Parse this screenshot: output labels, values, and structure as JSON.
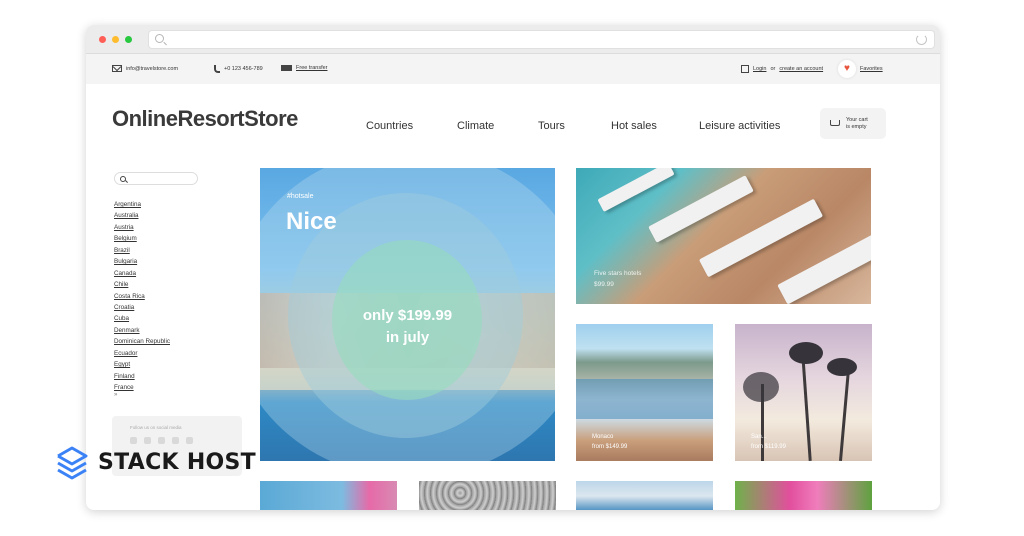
{
  "topbar": {
    "email": "info@travelstore.com",
    "phone": "+0 123 456-789",
    "transfer": "Free transfer",
    "login": "Login",
    "login_or": "or",
    "create_account": "create an account",
    "favorites": "Favorites"
  },
  "header": {
    "logo": "OnlineResortStore",
    "nav": [
      "Countries",
      "Climate",
      "Tours",
      "Hot sales",
      "Leisure activities"
    ],
    "cart_line1": "Your cart",
    "cart_line2": "is empty"
  },
  "sidebar": {
    "countries": [
      "Argentina",
      "Australia",
      "Austria",
      "Belgium",
      "Brazil",
      "Bulgaria",
      "Canada",
      "Chile",
      "Costa Rica",
      "Croatia",
      "Cuba",
      "Denmark",
      "Dominican Republic",
      "Ecuador",
      "Egypt",
      "Finland",
      "France"
    ],
    "more": "»",
    "social_label": "Follow us on social media"
  },
  "hero": {
    "tag": "#hotsale",
    "title": "Nice",
    "price_line1": "only $199.99",
    "price_line2": "in july"
  },
  "tiles": {
    "pool_line1": "Five stars hotels",
    "pool_line2": "$99.99",
    "harbor_line1": "Monaco",
    "harbor_line2": "from $149.99",
    "palms_line1": "San...",
    "palms_line2": "from $119.99"
  },
  "watermark": {
    "brand": "STACK HOST"
  },
  "colors": {
    "heart": "#e8553e",
    "text": "#333333",
    "topbar_bg": "#f4f4f4"
  }
}
